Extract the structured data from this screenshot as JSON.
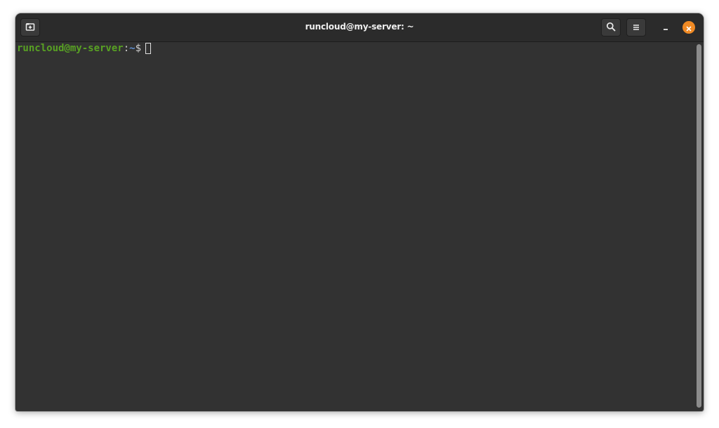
{
  "window": {
    "title": "runcloud@my-server: ~"
  },
  "titlebar": {
    "new_tab_icon": "new-tab-icon",
    "search_icon": "search-icon",
    "menu_icon": "hamburger-menu-icon",
    "minimize_icon": "minimize-icon",
    "close_icon": "close-icon"
  },
  "terminal": {
    "prompt_user": "runcloud@my-server",
    "prompt_sep": ":",
    "prompt_path": "~",
    "prompt_symbol": "$"
  },
  "colors": {
    "background": "#323232",
    "titlebar": "#2b2b2b",
    "prompt_user": "#58a123",
    "prompt_path": "#5f8fd0",
    "close_button": "#f08a24"
  }
}
